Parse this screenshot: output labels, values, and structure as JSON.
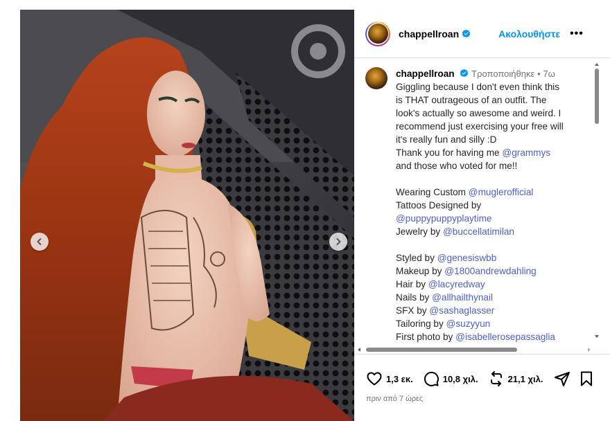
{
  "post": {
    "username": "chappellroan",
    "follow_label": "Ακολουθήστε",
    "more_label": "•••"
  },
  "caption": {
    "username": "chappellroan",
    "edited_label": "Τροποποιήθηκε",
    "separator": "•",
    "age": "7ω",
    "lines": [
      "Giggling because I don't even think this",
      "is THAT outrageous of an outfit. The",
      "look's actually so awesome and weird. I",
      "recommend just exercising your free will",
      "it's really fun and silly :D"
    ],
    "thanks_prefix": "Thank you for having me ",
    "thanks_mention": "@grammys",
    "voters_line": "and those who voted for me!!",
    "wearing_prefix": "Wearing Custom ",
    "wearing_mention": "@muglerofficial",
    "tattoos_line": "Tattoos Designed by",
    "tattoos_mention": "@puppypuppyplaytime",
    "jewelry_prefix": "Jewelry by ",
    "jewelry_mention": "@buccellatimilan",
    "credits": [
      {
        "prefix": "Styled by ",
        "mention": "@genesiswbb"
      },
      {
        "prefix": "Makeup by ",
        "mention": "@1800andrewdahling"
      },
      {
        "prefix": "Hair by ",
        "mention": "@lacyredway"
      },
      {
        "prefix": "Nails by ",
        "mention": "@allhailthynail"
      },
      {
        "prefix": "SFX by ",
        "mention": "@sashaglasser"
      },
      {
        "prefix": "Tailoring by ",
        "mention": "@suzyyun"
      },
      {
        "prefix": "First photo by ",
        "mention": "@isabellerosepassaglia"
      }
    ]
  },
  "actions": {
    "likes": "1,3 εκ.",
    "comments": "10,8 χιλ.",
    "reposts": "21,1 χιλ."
  },
  "timestamp": "πριν από 7 ώρες",
  "icons": {
    "prev": "chevron-left-icon",
    "next": "chevron-right-icon",
    "like": "heart-icon",
    "comment": "comment-bubble-icon",
    "repost": "repost-icon",
    "share": "paper-plane-icon",
    "save": "bookmark-icon",
    "verified": "verified-badge-icon"
  },
  "colors": {
    "link": "#0095f6",
    "mention": "#4a5fd5",
    "muted": "#737373"
  }
}
